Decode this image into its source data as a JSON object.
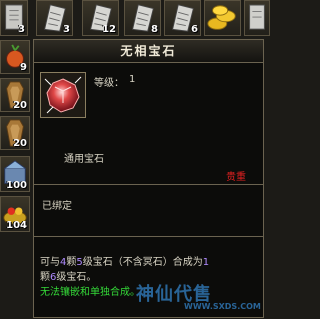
{
  "inventory": {
    "top_row": [
      {
        "icon": "scroll-icon",
        "qty": "3"
      },
      {
        "icon": "scroll-icon",
        "qty": "3"
      },
      {
        "icon": "scroll-icon",
        "qty": "12"
      },
      {
        "icon": "scroll-icon",
        "qty": "8"
      },
      {
        "icon": "gold-ingot-icon",
        "qty": "6"
      },
      {
        "icon": "scroll-icon",
        "qty": ""
      }
    ],
    "left_column": [
      {
        "icon": "herb-icon",
        "qty": "9"
      },
      {
        "icon": "coffin-icon",
        "qty": "20"
      },
      {
        "icon": "coffin-icon",
        "qty": "20"
      },
      {
        "icon": "treasure-icon",
        "qty": "100"
      },
      {
        "icon": "treasure-bowl-icon",
        "qty": "104"
      }
    ]
  },
  "tooltip": {
    "title": "无相宝石",
    "level_label": "等级：",
    "level_value": "1",
    "category": "通用宝石",
    "value_tag": "贵重",
    "bind_status": "已绑定",
    "description_parts": {
      "p1": "可与",
      "n1": "4",
      "p2": "颗",
      "n2": "5",
      "p3": "级宝石（不含冥石）合成为",
      "n3": "1",
      "p4": "颗",
      "n4": "6",
      "p5": "级宝石。"
    },
    "restriction": "无法镶嵌和单独合成。"
  },
  "watermark": {
    "brand": "神仙代售",
    "url": "WWW.SXDS.COM"
  },
  "colors": {
    "value_tag": "#e02020",
    "numbers": "#b08cff",
    "restriction": "#34d838"
  }
}
